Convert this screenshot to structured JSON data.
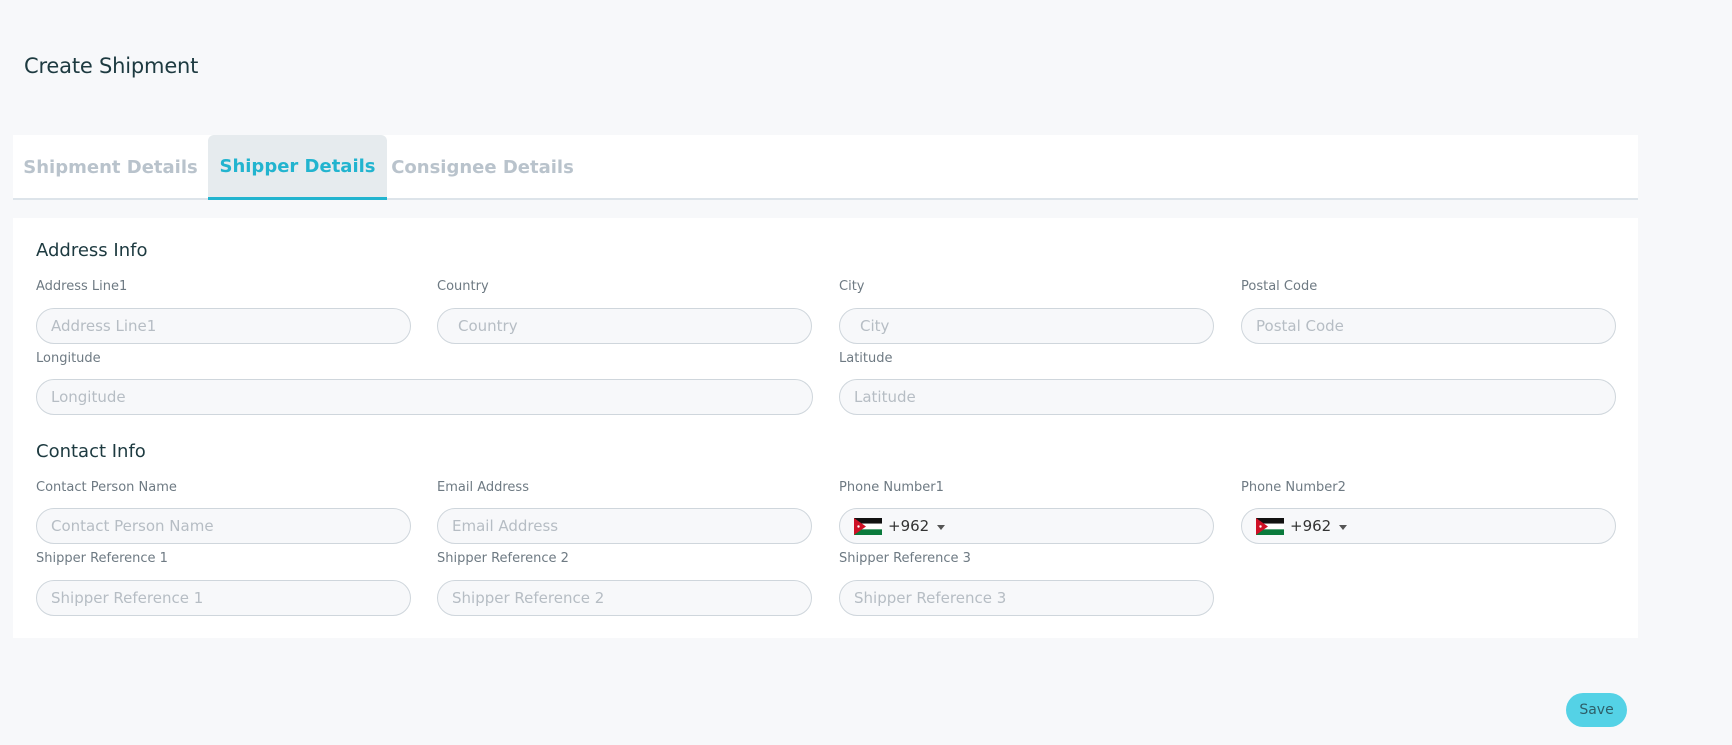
{
  "page": {
    "title": "Create Shipment"
  },
  "tabs": [
    {
      "label": "Shipment Details",
      "active": false
    },
    {
      "label": "Shipper Details",
      "active": true
    },
    {
      "label": "Consignee Details",
      "active": false
    }
  ],
  "address": {
    "section_title": "Address Info",
    "address_line1": {
      "label": "Address Line1",
      "placeholder": "Address Line1"
    },
    "country": {
      "label": "Country",
      "placeholder": "Country"
    },
    "city": {
      "label": "City",
      "placeholder": "City"
    },
    "postal_code": {
      "label": "Postal Code",
      "placeholder": "Postal Code"
    },
    "longitude": {
      "label": "Longitude",
      "placeholder": "Longitude"
    },
    "latitude": {
      "label": "Latitude",
      "placeholder": "Latitude"
    }
  },
  "contact": {
    "section_title": "Contact Info",
    "contact_person": {
      "label": "Contact Person Name",
      "placeholder": "Contact Person Name"
    },
    "email": {
      "label": "Email Address",
      "placeholder": "Email Address"
    },
    "phone1": {
      "label": "Phone Number1",
      "dial_code": "+962",
      "flag": "jordan-flag-icon"
    },
    "phone2": {
      "label": "Phone Number2",
      "dial_code": "+962",
      "flag": "jordan-flag-icon"
    },
    "ref1": {
      "label": "Shipper Reference 1",
      "placeholder": "Shipper Reference 1"
    },
    "ref2": {
      "label": "Shipper Reference 2",
      "placeholder": "Shipper Reference 2"
    },
    "ref3": {
      "label": "Shipper Reference 3",
      "placeholder": "Shipper Reference 3"
    }
  },
  "actions": {
    "save_label": "Save"
  },
  "colors": {
    "accent": "#22b4cf",
    "save_button": "#54d2e6",
    "background": "#f7f8fa",
    "tab_inactive": "#b9c3cc"
  }
}
